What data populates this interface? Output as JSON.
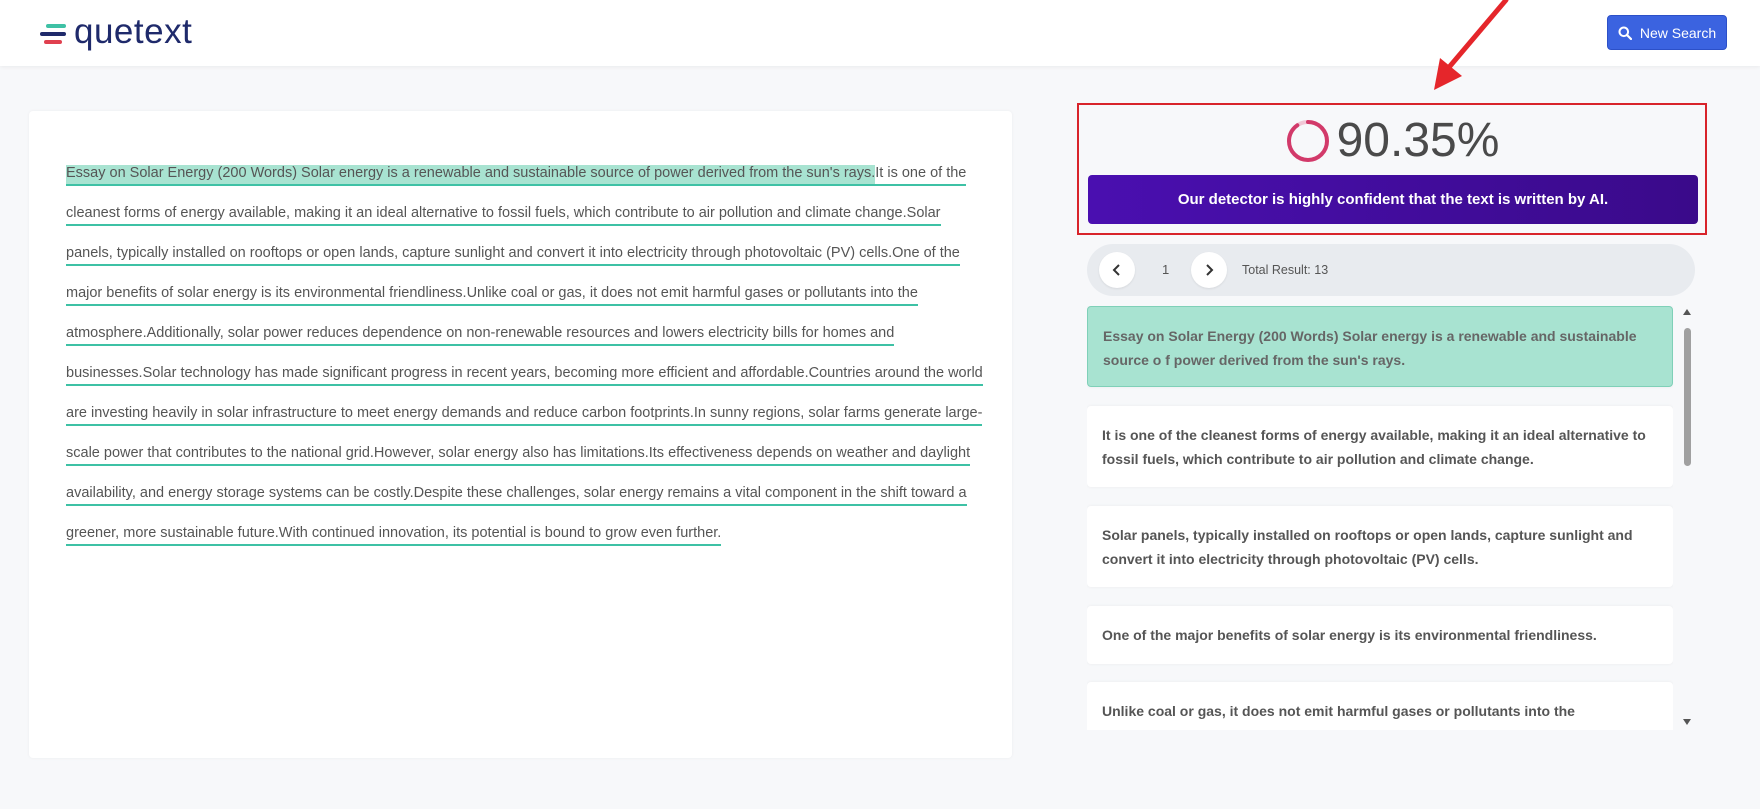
{
  "header": {
    "logo_text": "quetext",
    "new_search_label": "New Search",
    "search_icon": "search-icon"
  },
  "essay": {
    "segments": [
      "Essay on Solar Energy (200 Words) Solar energy is a renewable and sustainable source of power derived from the sun's rays.",
      "It is one of the cleanest forms of energy available, making it an ideal alternative to fossil fuels, which contribute to air pollution and climate change.",
      "Solar panels, typically installed on rooftops or open lands, capture sunlight and convert it into electricity through photovoltaic (PV) cells.",
      "One of the major benefits of solar energy is its environmental friendliness.",
      "Unlike coal or gas, it does not emit harmful gases or pollutants into the atmosphere.",
      "Additionally, solar power reduces dependence on non-renewable resources and lowers electricity bills for homes and businesses.",
      "Solar technology has made significant progress in recent years, becoming more efficient and affordable.",
      "Countries around the world are investing heavily in solar infrastructure to meet energy demands and reduce carbon footprints.",
      "In sunny regions, solar farms generate large-scale power that contributes to the national grid.",
      "However, solar energy also has limitations.",
      "Its effectiveness depends on weather and daylight availability, and energy storage systems can be costly.",
      "Despite these challenges, solar energy remains a vital component in the shift toward a greener, more sustainable future.",
      "With continued innovation, its potential is bound to grow even further."
    ],
    "active_segment": 0
  },
  "result": {
    "score_text": "90.35%",
    "score_value": 90.35,
    "verdict": "Our detector is highly confident that the text is written by AI.",
    "ring_color": "#d23a6a",
    "verdict_color": "#4a0fb0"
  },
  "pager": {
    "page": "1",
    "total": "Total Result: 13"
  },
  "cards": [
    "Essay on Solar Energy (200 Words) Solar energy is a renewable and sustainable source o f power derived from the sun's rays.",
    "It is one of the cleanest forms of energy available, making it an ideal alternative to fossil fuels, which contribute to air pollution and climate change.",
    "Solar panels, typically installed on rooftops or open lands, capture sunlight and convert it into electricity through photovoltaic (PV) cells.",
    "One of the major benefits of solar energy is its environmental friendliness.",
    "Unlike coal or gas, it does not emit harmful gases or pollutants into the atmosphere."
  ],
  "colors": {
    "accent": "#3b63e0",
    "highlight": "#a8e3d1",
    "underline": "#3ec1a5",
    "annotation": "#d8232a"
  }
}
